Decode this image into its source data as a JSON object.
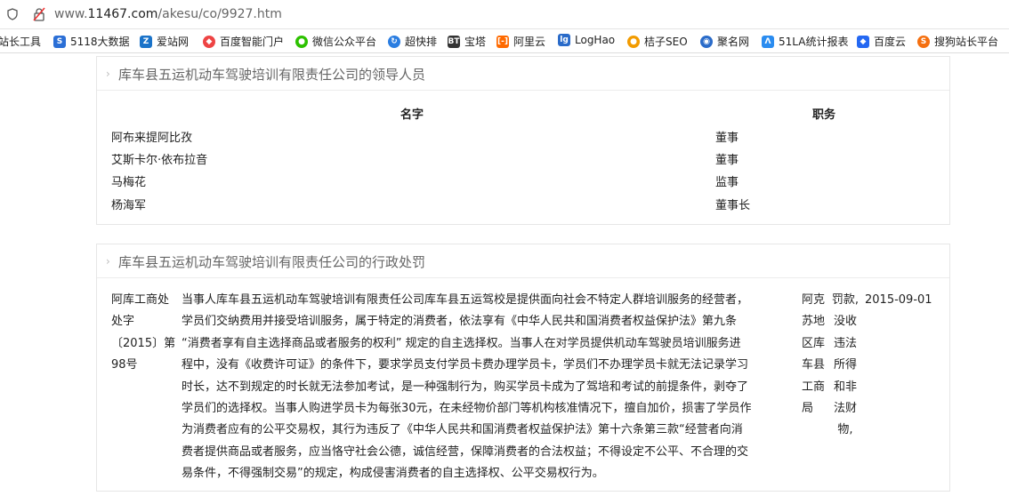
{
  "browser": {
    "url_prefix": "www.",
    "url_domain": "11467.com",
    "url_path": "/akesu/co/9927.htm"
  },
  "bookmarks": [
    {
      "label": "站长工具",
      "icon": "none",
      "color": ""
    },
    {
      "label": "5118大数据",
      "icon": "5118-icon",
      "color": "#2b6fd6"
    },
    {
      "label": "爱站网",
      "icon": "aizhan-icon",
      "color": "#1a73c9"
    },
    {
      "label": "百度智能门户",
      "icon": "baidu-portal-icon",
      "color": "#e44"
    },
    {
      "label": "微信公众平台",
      "icon": "wechat-icon",
      "color": "#2dc100"
    },
    {
      "label": "超快排",
      "icon": "chaokuaipai-icon",
      "color": "#2a7de1"
    },
    {
      "label": "宝塔",
      "icon": "bt-icon",
      "color": "#333"
    },
    {
      "label": "阿里云",
      "icon": "aliyun-icon",
      "color": "#ff6a00"
    },
    {
      "label": "LogHao",
      "icon": "loghao-icon",
      "color": "#2a6bc9"
    },
    {
      "label": "桔子SEO",
      "icon": "juzi-icon",
      "color": "#f29b00"
    },
    {
      "label": "聚名网",
      "icon": "juming-icon",
      "color": "#2a6bc9"
    },
    {
      "label": "51LA统计报表",
      "icon": "51la-icon",
      "color": "#2a8cf0"
    },
    {
      "label": "百度云",
      "icon": "baiduyun-icon",
      "color": "#2468f2"
    },
    {
      "label": "搜狗站长平台",
      "icon": "sogou-icon",
      "color": "#f56f0f"
    }
  ],
  "leaders": {
    "title": "库车县五运机动车驾驶培训有限责任公司的领导人员",
    "col_name": "名字",
    "col_role": "职务",
    "rows": [
      {
        "name": "阿布来提阿比孜",
        "role": "董事"
      },
      {
        "name": "艾斯卡尔·依布拉音",
        "role": "董事"
      },
      {
        "name": "马梅花",
        "role": "监事"
      },
      {
        "name": "杨海军",
        "role": "董事长"
      }
    ]
  },
  "penalty": {
    "title": "库车县五运机动车驾驶培训有限责任公司的行政处罚",
    "doc_no_lines": [
      "阿库工商处",
      "处字",
      "〔2015〕第",
      "98号"
    ],
    "content_lines": [
      "当事人库车县五运机动车驾驶培训有限责任公司库车县五运驾校是提供面向社会不特定人群培训服务的经营者，",
      "学员们交纳费用并接受培训服务，属于特定的消费者，依法享有《中华人民共和国消费者权益保护法》第九条",
      "“消费者享有自主选择商品或者服务的权利” 规定的自主选择权。当事人在对学员提供机动车驾驶员培训服务进",
      "程中，没有《收费许可证》的条件下，要求学员支付学员卡费办理学员卡，学员们不办理学员卡就无法记录学习",
      "时长，达不到规定的时长就无法参加考试，是一种强制行为，购买学员卡成为了驾培和考试的前提条件，剥夺了",
      "学员们的选择权。当事人购进学员卡为每张30元，在未经物价部门等机构核准情况下，擅自加价，损害了学员作",
      "为消费者应有的公平交易权，其行为违反了《中华人民共和国消费者权益保护法》第十六条第三款“经营者向消",
      "费者提供商品或者服务，应当恪守社会公德，诚信经营，保障消费者的合法权益；不得设定不公平、不合理的交",
      "易条件，不得强制交易”的规定，构成侵害消费者的自主选择权、公平交易权行为。"
    ],
    "authority_lines": [
      "阿克",
      "苏地",
      "区库",
      "车县",
      "工商",
      "局"
    ],
    "result_lines": [
      "罚款,",
      "没收",
      "违法",
      "所得",
      "和非",
      "法财",
      "物,"
    ],
    "date": "2015-09-01"
  }
}
